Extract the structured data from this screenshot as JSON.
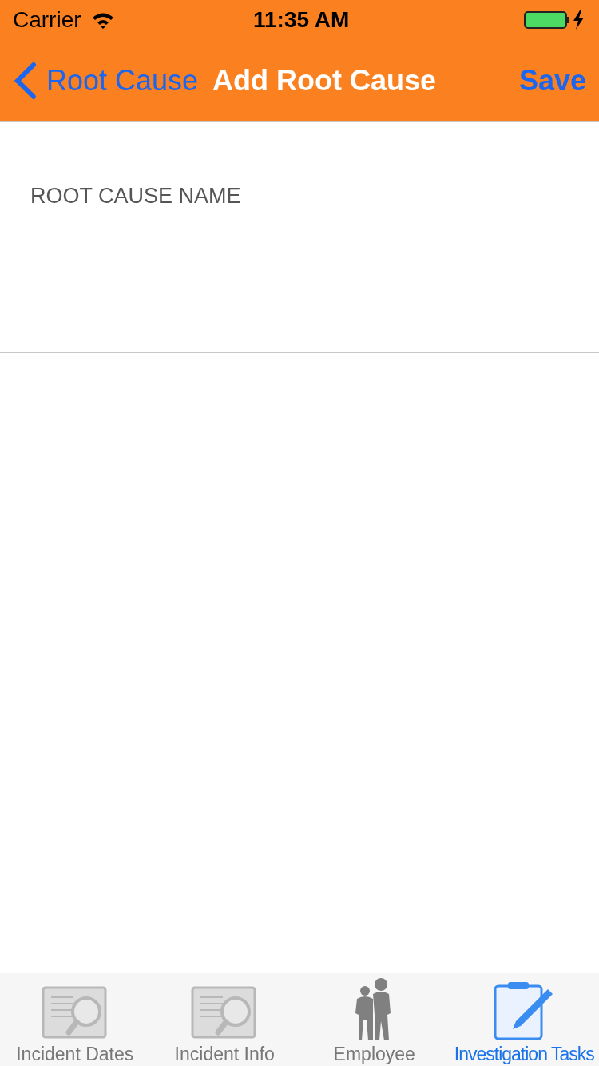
{
  "status_bar": {
    "carrier": "Carrier",
    "time": "11:35 AM"
  },
  "nav": {
    "back": "Root Cause",
    "title": "Add Root Cause",
    "action": "Save"
  },
  "section": {
    "header": "ROOT CAUSE NAME"
  },
  "tabs": [
    {
      "label": "Incident Dates",
      "kind": "document",
      "selected": false
    },
    {
      "label": "Incident Info",
      "kind": "document",
      "selected": false
    },
    {
      "label": "Employee",
      "kind": "people",
      "selected": false
    },
    {
      "label": "Investigation Tasks",
      "kind": "clipboard",
      "selected": true
    }
  ]
}
